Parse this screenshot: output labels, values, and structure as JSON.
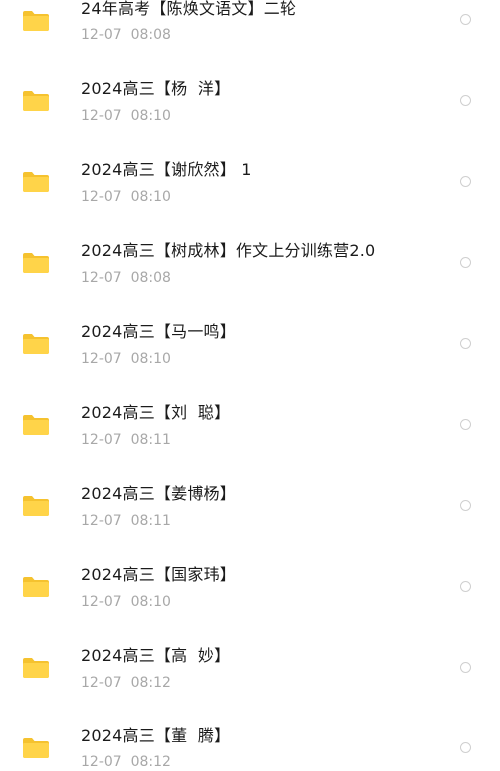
{
  "files": [
    {
      "name": "24年高考【陈焕文语文】二轮",
      "time": "12-07  08:08",
      "icon": "folder-icon"
    },
    {
      "name": "2024高三【杨  洋】",
      "time": "12-07  08:10",
      "icon": "folder-icon"
    },
    {
      "name": "2024高三【谢欣然】 1",
      "time": "12-07  08:10",
      "icon": "folder-icon"
    },
    {
      "name": "2024高三【树成林】作文上分训练营2.0",
      "time": "12-07  08:08",
      "icon": "folder-icon"
    },
    {
      "name": "2024高三【马一鸣】",
      "time": "12-07  08:10",
      "icon": "folder-icon"
    },
    {
      "name": "2024高三【刘  聪】",
      "time": "12-07  08:11",
      "icon": "folder-icon"
    },
    {
      "name": "2024高三【姜博杨】",
      "time": "12-07  08:11",
      "icon": "folder-icon"
    },
    {
      "name": "2024高三【国家玮】",
      "time": "12-07  08:10",
      "icon": "folder-icon"
    },
    {
      "name": "2024高三【高  妙】",
      "time": "12-07  08:12",
      "icon": "folder-icon"
    },
    {
      "name": "2024高三【董  腾】",
      "time": "12-07  08:12",
      "icon": "folder-icon"
    }
  ],
  "colors": {
    "folder_body": "#ffd449",
    "folder_tab": "#f5c22f",
    "name_text": "#1b1b1b",
    "time_text": "#a8a8a8",
    "radio_border": "#cfcfcf"
  }
}
